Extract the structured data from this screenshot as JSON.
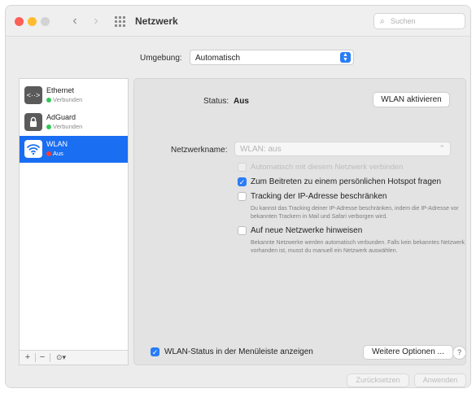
{
  "window": {
    "title": "Netzwerk"
  },
  "toolbar": {
    "back_icon": "chevron-left-icon",
    "forward_icon": "chevron-right-icon",
    "grid_icon": "grid-icon",
    "search_placeholder": "Suchen",
    "search_icon": "search-icon"
  },
  "location": {
    "label": "Umgebung:",
    "value": "Automatisch"
  },
  "services": [
    {
      "name": "Ethernet",
      "status": "Verbunden",
      "status_color": "#34c759",
      "icon": "ethernet-icon",
      "selected": false
    },
    {
      "name": "AdGuard",
      "status": "Verbunden",
      "status_color": "#34c759",
      "icon": "vpn-lock-icon",
      "selected": false
    },
    {
      "name": "WLAN",
      "status": "Aus",
      "status_color": "#ff3b30",
      "icon": "wifi-icon",
      "selected": true
    }
  ],
  "sidebar_footer": {
    "add": "+",
    "remove": "−",
    "action": "⊙▾"
  },
  "detail": {
    "status_label": "Status:",
    "status_value": "Aus",
    "wlan_button": "WLAN aktivieren",
    "network_name_label": "Netzwerkname:",
    "network_name_value": "WLAN: aus",
    "auto_join": {
      "label": "Automatisch mit diesem Netzwerk verbinden",
      "checked": false,
      "disabled": true
    },
    "hotspot": {
      "label": "Zum Beitreten zu einem persönlichen Hotspot fragen",
      "checked": true
    },
    "limit_ip": {
      "label": "Tracking der IP-Adresse beschränken",
      "checked": false,
      "description": "Du kannst das Tracking deiner IP-Adresse beschränken, indem die IP-Adresse vor bekannten Trackern in Mail und Safari verborgen wird."
    },
    "ask_new": {
      "label": "Auf neue Netzwerke hinweisen",
      "checked": false,
      "description": "Bekannte Netzwerke werden automatisch verbunden. Falls kein bekanntes Netzwerk vorhanden ist, musst du manuell ein Netzwerk auswählen."
    },
    "menubar_status": {
      "label": "WLAN-Status in der Menüleiste anzeigen",
      "checked": true
    },
    "advanced_button": "Weitere Optionen ...",
    "help_button": "?"
  },
  "bottom": {
    "revert_button": "Zurücksetzen",
    "apply_button": "Anwenden"
  },
  "colors": {
    "accent": "#2a7cf7",
    "selection": "#1a6ef2",
    "connected": "#34c759",
    "off": "#ff3b30"
  }
}
